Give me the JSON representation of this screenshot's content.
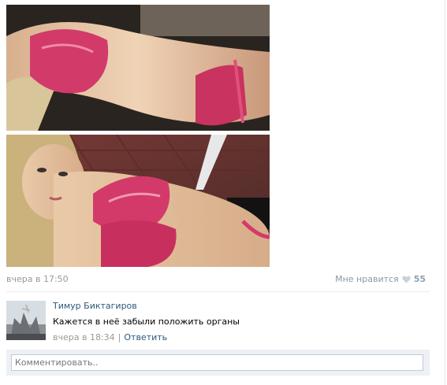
{
  "post": {
    "time": "вчера в 17:50",
    "like_label": "Мне нравится",
    "like_count": "55"
  },
  "comment": {
    "author": "Тимур Биктагиров",
    "text": "Кажется в неё забыли положить органы",
    "time": "вчера в 18:34",
    "separator": "|",
    "reply_label": "Ответить"
  },
  "reply_box": {
    "placeholder": "Комментировать.."
  },
  "icons": {
    "like": "heart-icon"
  },
  "colors": {
    "link": "#2b587a",
    "meta": "#999999",
    "like_count": "#8fa1b4",
    "reply_bg": "#edf1f5"
  }
}
